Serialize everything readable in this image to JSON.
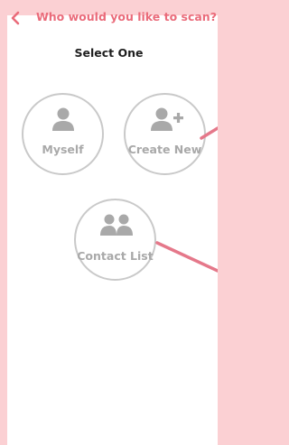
{
  "header": {
    "back_icon": "chevron-left-icon",
    "title": "Who would you like to scan?"
  },
  "subtitle": "Select One",
  "options": [
    {
      "label": "Myself",
      "icon": "person-icon"
    },
    {
      "label": "Create New",
      "icon": "person-add-icon"
    },
    {
      "label": "Contact List",
      "icon": "people-icon"
    }
  ],
  "colors": {
    "accent": "#ea6b7a",
    "background": "#fbd0d3",
    "muted": "#a9a9a9"
  }
}
